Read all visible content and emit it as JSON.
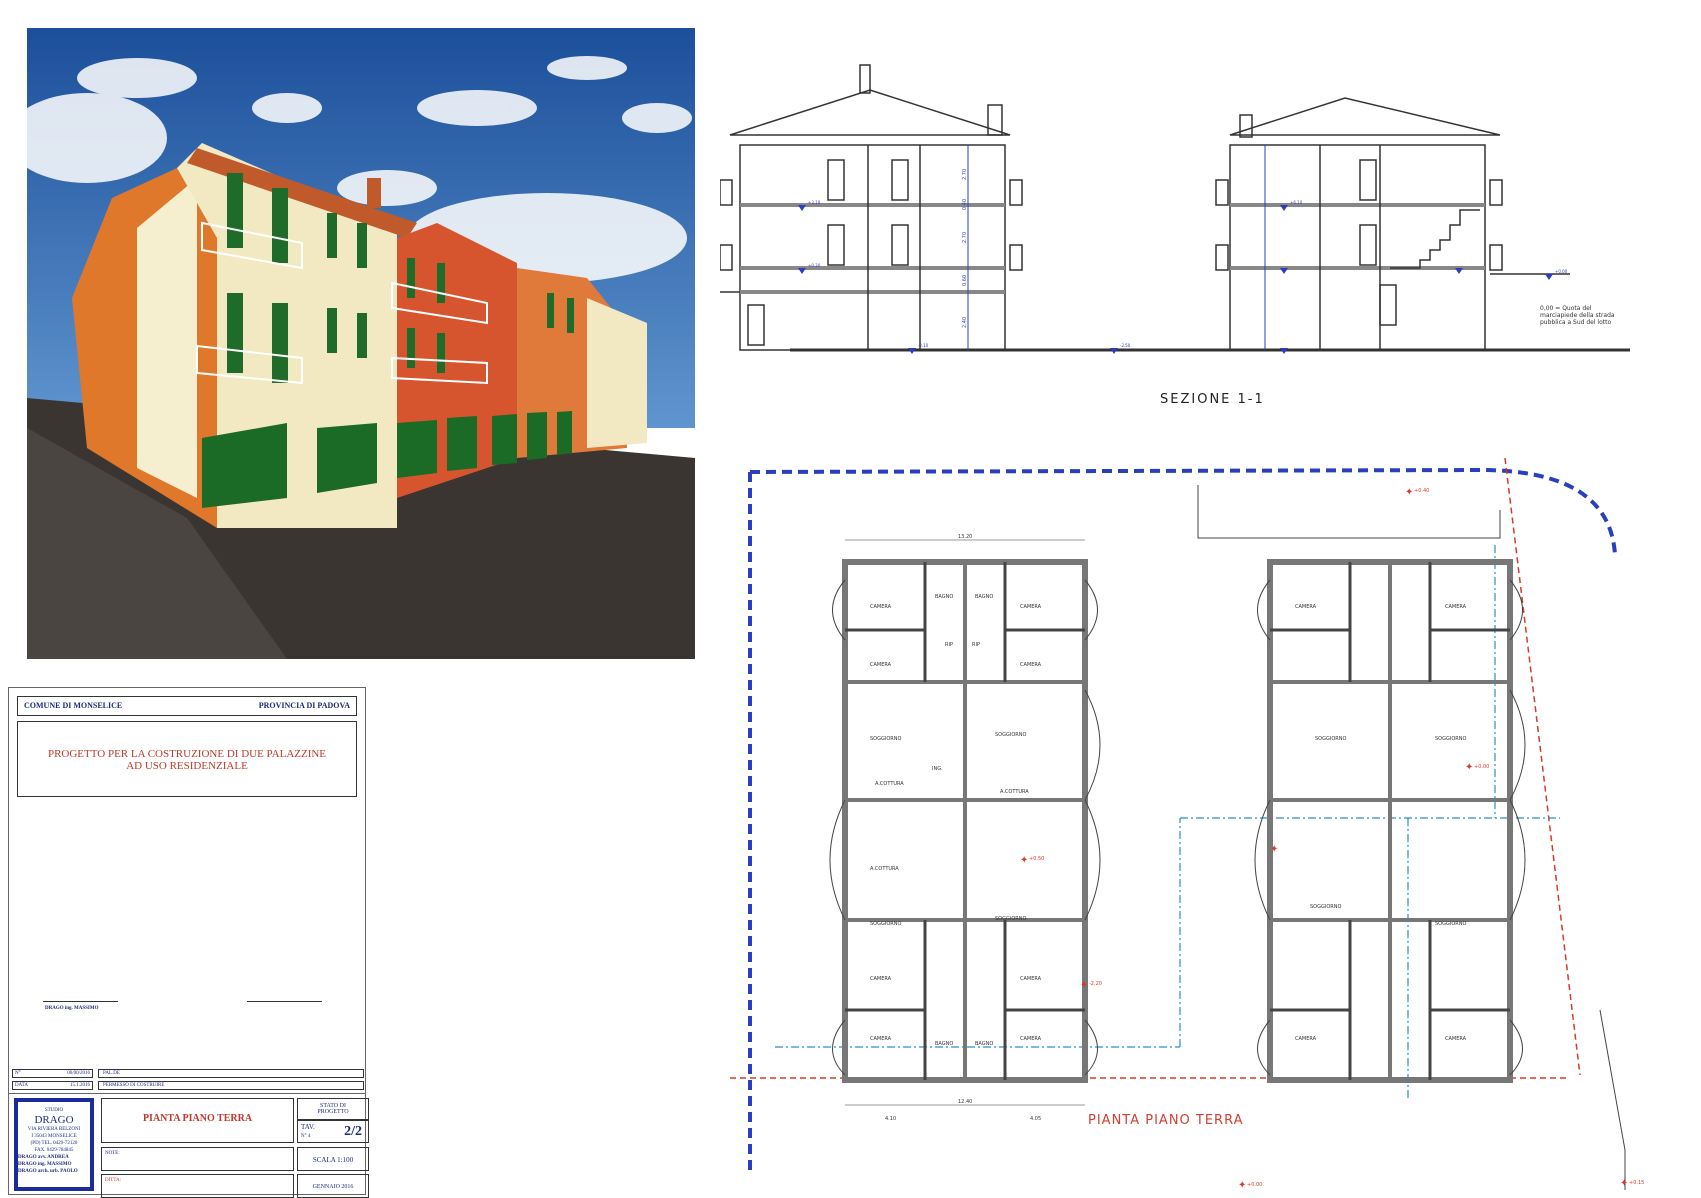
{
  "section": {
    "title": "SEZIONE 1-1",
    "note": "0,00 = Quota del marciapiede della strada pubblica a Sud del lotto",
    "levels": [
      "+0.30",
      "+3.10",
      "+6.10",
      "-2.10",
      "-2.50",
      "+0.00"
    ],
    "heights": [
      "2.70",
      "0.40",
      "2.70",
      "0.60",
      "2.40"
    ]
  },
  "plan": {
    "title": "PIANTA PIANO TERRA",
    "rooms": {
      "camera": "CAMERA",
      "bagno": "BAGNO",
      "rip": "RIP",
      "soggiorno": "SOGGIORNO",
      "cottura": "A.COTTURA",
      "ing": "ING."
    },
    "dims": {
      "total_width": "13.20",
      "d1": "4.10",
      "d2": "4.05",
      "d3": "12.40"
    },
    "levels": [
      "+0.40",
      "+0.00",
      "+0.50",
      "-2.20",
      "+0.00",
      "+0.15"
    ]
  },
  "titleblock": {
    "comune": "COMUNE DI MONSELICE",
    "provincia": "PROVINCIA DI PADOVA",
    "project_line1": "PROGETTO PER LA COSTRUZIONE DI DUE PALAZZINE",
    "project_line2": "AD USO RESIDENZIALE",
    "signature": "DRAGO ing. MASSIMO",
    "prot_label": "N°",
    "prot_value": "00/00/2016",
    "data_label": "DATA",
    "data_value": "15.1.2016",
    "row1": "PAL.DE",
    "row2": "PERMESSO DI COSTRUIRE",
    "studio_label": "STUDIO",
    "studio_name": "DRAGO",
    "studio_addr1": "VIA RIVIERA BELZONI",
    "studio_addr2": "I 35043 MONSELICE",
    "studio_addr3": "(PD) TEL. 0429-72120",
    "studio_addr4": "FAX. 0429-784845",
    "person1": "DRAGO avv. ANDREA",
    "person2": "DRAGO ing. MASSIMO",
    "person3": "DRAGO arch. urb. PAOLO",
    "drawing_title": "PIANTA PIANO TERRA",
    "stato": "STATO DI PROGETTO",
    "tav_label": "TAV.",
    "tav_sub": "N° 4",
    "tav_value": "2/2",
    "note_label": "NOTE:",
    "ditta_label": "DITTA:",
    "scala": "SCALA 1:100",
    "date": "GENNAIO 2016"
  },
  "colors": {
    "dim_blue": "#2a3fbf",
    "red_line": "#d63a2a",
    "navy": "#1a2b7a",
    "shutter_green": "#1f6b2a"
  }
}
